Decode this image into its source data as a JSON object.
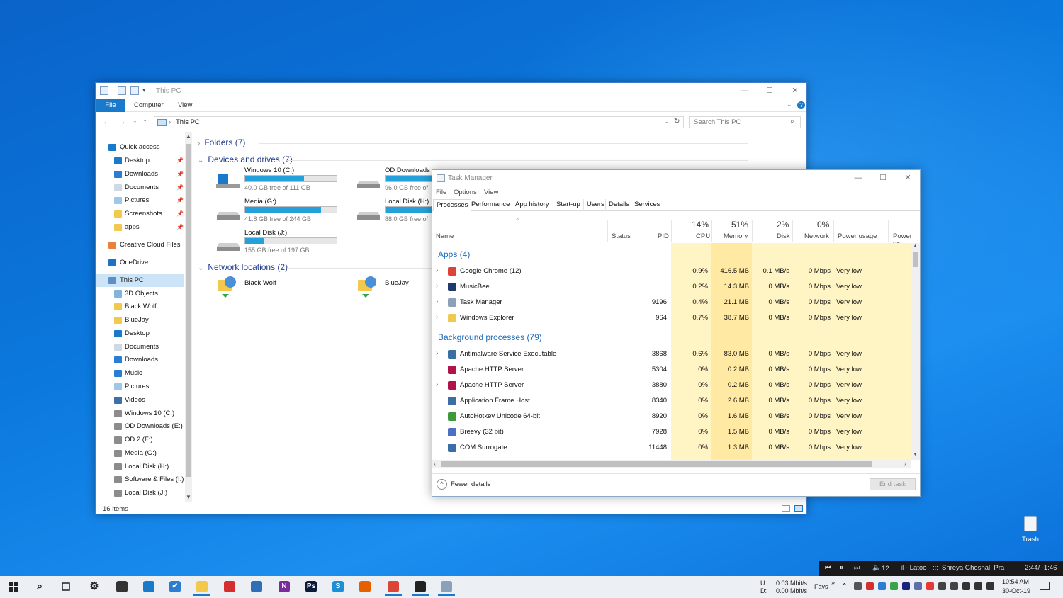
{
  "explorer": {
    "title": "This PC",
    "ribbon_tabs": [
      "File",
      "Computer",
      "View"
    ],
    "address": "This PC",
    "search_placeholder": "Search This PC",
    "nav": [
      {
        "label": "Quick access",
        "icon": "star-icon",
        "pinned": false
      },
      {
        "label": "Desktop",
        "icon": "desktop-icon",
        "pinned": true
      },
      {
        "label": "Downloads",
        "icon": "download-icon",
        "pinned": true
      },
      {
        "label": "Documents",
        "icon": "document-icon",
        "pinned": true
      },
      {
        "label": "Pictures",
        "icon": "pictures-icon",
        "pinned": true
      },
      {
        "label": "Screenshots",
        "icon": "folder-icon",
        "pinned": true
      },
      {
        "label": "apps",
        "icon": "folder-icon",
        "pinned": true
      },
      {
        "label": "Creative Cloud Files",
        "icon": "cloud-folder-icon",
        "pinned": false
      },
      {
        "label": "OneDrive",
        "icon": "onedrive-icon",
        "pinned": false
      },
      {
        "label": "This PC",
        "icon": "computer-icon",
        "pinned": false
      },
      {
        "label": "3D Objects",
        "icon": "cube-icon",
        "pinned": false
      },
      {
        "label": "Black Wolf",
        "icon": "network-drive-icon",
        "pinned": false
      },
      {
        "label": "BlueJay",
        "icon": "network-drive-icon",
        "pinned": false
      },
      {
        "label": "Desktop",
        "icon": "desktop-icon",
        "pinned": false
      },
      {
        "label": "Documents",
        "icon": "document-icon",
        "pinned": false
      },
      {
        "label": "Downloads",
        "icon": "download-icon",
        "pinned": false
      },
      {
        "label": "Music",
        "icon": "music-icon",
        "pinned": false
      },
      {
        "label": "Pictures",
        "icon": "pictures-icon",
        "pinned": false
      },
      {
        "label": "Videos",
        "icon": "video-icon",
        "pinned": false
      },
      {
        "label": "Windows 10 (C:)",
        "icon": "drive-icon",
        "pinned": false
      },
      {
        "label": "OD Downloads  (E:)",
        "icon": "drive-icon",
        "pinned": false
      },
      {
        "label": "OD 2 (F:)",
        "icon": "drive-icon",
        "pinned": false
      },
      {
        "label": "Media (G:)",
        "icon": "drive-icon",
        "pinned": false
      },
      {
        "label": "Local Disk (H:)",
        "icon": "drive-icon",
        "pinned": false
      },
      {
        "label": "Software & Files (I:)",
        "icon": "drive-icon",
        "pinned": false
      },
      {
        "label": "Local Disk (J:)",
        "icon": "drive-icon",
        "pinned": false
      }
    ],
    "groups": {
      "folders": "Folders (7)",
      "devices": "Devices and drives (7)",
      "network": "Network locations (2)"
    },
    "drives": [
      {
        "name": "Windows 10 (C:)",
        "free": "40.0 GB free of 111 GB",
        "used_pct": 64
      },
      {
        "name": "Media (G:)",
        "free": "41.8 GB free of 244 GB",
        "used_pct": 83
      },
      {
        "name": "Local Disk (J:)",
        "free": "155 GB free of 197 GB",
        "used_pct": 21
      },
      {
        "name": "OD Downloads",
        "free": "96.0 GB free of",
        "used_pct": 60
      },
      {
        "name": "Local Disk (H:)",
        "free": "88.0 GB free of",
        "used_pct": 55
      }
    ],
    "network_locations": [
      "Black Wolf",
      "BlueJay"
    ],
    "status": "16 items"
  },
  "taskmanager": {
    "title": "Task Manager",
    "menu": [
      "File",
      "Options",
      "View"
    ],
    "tabs": [
      "Processes",
      "Performance",
      "App history",
      "Start-up",
      "Users",
      "Details",
      "Services"
    ],
    "headers": {
      "name": "Name",
      "status": "Status",
      "pid": "PID",
      "cpu_pct": "14%",
      "cpu": "CPU",
      "mem_pct": "51%",
      "mem": "Memory",
      "disk_pct": "2%",
      "disk": "Disk",
      "net_pct": "0%",
      "net": "Network",
      "power": "Power usage",
      "power_trend": "Power us"
    },
    "apps_group": "Apps (4)",
    "bg_group": "Background processes (79)",
    "apps": [
      {
        "name": "Google Chrome (12)",
        "pid": "",
        "cpu": "0.9%",
        "mem": "416.5 MB",
        "disk": "0.1 MB/s",
        "net": "0 Mbps",
        "power": "Very low",
        "icon": "chrome-icon",
        "color": "#db4437",
        "expand": true
      },
      {
        "name": "MusicBee",
        "pid": "",
        "cpu": "0.2%",
        "mem": "14.3 MB",
        "disk": "0 MB/s",
        "net": "0 Mbps",
        "power": "Very low",
        "icon": "musicbee-icon",
        "color": "#1f3a6b",
        "expand": true
      },
      {
        "name": "Task Manager",
        "pid": "9196",
        "cpu": "0.4%",
        "mem": "21.1 MB",
        "disk": "0 MB/s",
        "net": "0 Mbps",
        "power": "Very low",
        "icon": "task-manager-icon",
        "color": "#8aa1b8",
        "expand": true
      },
      {
        "name": "Windows Explorer",
        "pid": "964",
        "cpu": "0.7%",
        "mem": "38.7 MB",
        "disk": "0 MB/s",
        "net": "0 Mbps",
        "power": "Very low",
        "icon": "folder-icon",
        "color": "#f2c94c",
        "expand": true
      }
    ],
    "background": [
      {
        "name": "Antimalware Service Executable",
        "pid": "3868",
        "cpu": "0.6%",
        "mem": "83.0 MB",
        "disk": "0 MB/s",
        "net": "0 Mbps",
        "power": "Very low",
        "icon": "service-icon",
        "color": "#3a6ea5",
        "expand": true
      },
      {
        "name": "Apache HTTP Server",
        "pid": "5304",
        "cpu": "0%",
        "mem": "0.2 MB",
        "disk": "0 MB/s",
        "net": "0 Mbps",
        "power": "Very low",
        "icon": "apache-feather-icon",
        "color": "#b0124a",
        "expand": false
      },
      {
        "name": "Apache HTTP Server",
        "pid": "3880",
        "cpu": "0%",
        "mem": "0.2 MB",
        "disk": "0 MB/s",
        "net": "0 Mbps",
        "power": "Very low",
        "icon": "apache-feather-icon",
        "color": "#b0124a",
        "expand": true
      },
      {
        "name": "Application Frame Host",
        "pid": "8340",
        "cpu": "0%",
        "mem": "2.6 MB",
        "disk": "0 MB/s",
        "net": "0 Mbps",
        "power": "Very low",
        "icon": "service-icon",
        "color": "#3a6ea5",
        "expand": false
      },
      {
        "name": "AutoHotkey Unicode 64-bit",
        "pid": "8920",
        "cpu": "0%",
        "mem": "1.6 MB",
        "disk": "0 MB/s",
        "net": "0 Mbps",
        "power": "Very low",
        "icon": "autohotkey-icon",
        "color": "#3c9a3c",
        "expand": false
      },
      {
        "name": "Breevy (32 bit)",
        "pid": "7928",
        "cpu": "0%",
        "mem": "1.5 MB",
        "disk": "0 MB/s",
        "net": "0 Mbps",
        "power": "Very low",
        "icon": "breevy-icon",
        "color": "#4a6fc4",
        "expand": false
      },
      {
        "name": "COM Surrogate",
        "pid": "11448",
        "cpu": "0%",
        "mem": "1.3 MB",
        "disk": "0 MB/s",
        "net": "0 Mbps",
        "power": "Very low",
        "icon": "service-icon",
        "color": "#3a6ea5",
        "expand": false
      }
    ],
    "fewer_details": "Fewer details",
    "end_task": "End task"
  },
  "taskbar": {
    "apps": [
      {
        "name": "start-button",
        "glyph": "",
        "color": "#222"
      },
      {
        "name": "search-icon",
        "glyph": "",
        "color": "#222"
      },
      {
        "name": "task-view-icon",
        "glyph": "",
        "color": "#222"
      },
      {
        "name": "settings-icon",
        "glyph": "⚙",
        "color": "#222"
      },
      {
        "name": "terminal-icon",
        "glyph": "",
        "color": "#333"
      },
      {
        "name": "phone-icon",
        "glyph": "",
        "color": "#1979ca"
      },
      {
        "name": "todo-icon",
        "glyph": "✔",
        "color": "#2b7cd3"
      },
      {
        "name": "file-explorer-icon",
        "glyph": "",
        "color": "#f2c94c"
      },
      {
        "name": "app-red-icon",
        "glyph": "",
        "color": "#d32f2f"
      },
      {
        "name": "github-icon",
        "glyph": "",
        "color": "#2f6fb8"
      },
      {
        "name": "onenote-icon",
        "glyph": "N",
        "color": "#7b2c9c"
      },
      {
        "name": "photoshop-icon",
        "glyph": "Ps",
        "color": "#0b1a3a"
      },
      {
        "name": "snagit-icon",
        "glyph": "S",
        "color": "#1e8fd6"
      },
      {
        "name": "firefox-icon",
        "glyph": "",
        "color": "#e66000"
      },
      {
        "name": "chrome-icon",
        "glyph": "",
        "color": "#db4437"
      },
      {
        "name": "musicbee-icon",
        "glyph": "",
        "color": "#222"
      },
      {
        "name": "task-manager-icon",
        "glyph": "",
        "color": "#8aa1b8"
      }
    ],
    "net_up": "U:",
    "net_down": "D:",
    "net_up_val": "0.03 Mbit/s",
    "net_down_val": "0.00 Mbit/s",
    "favs": "Favs",
    "time": "10:54 AM",
    "date": "30-Oct-19"
  },
  "media": {
    "volume": "12",
    "track": "il - Latoo",
    "artist": "Shreya Ghoshal, Pra",
    "position": "2:44/ -1:46"
  },
  "desktop": {
    "trash_label": "Trash"
  },
  "colors": {
    "accent": "#1979ca",
    "heat_light": "#fff4c4",
    "heat_mid": "#ffe9a3",
    "drive_bar": "#26a0da"
  }
}
